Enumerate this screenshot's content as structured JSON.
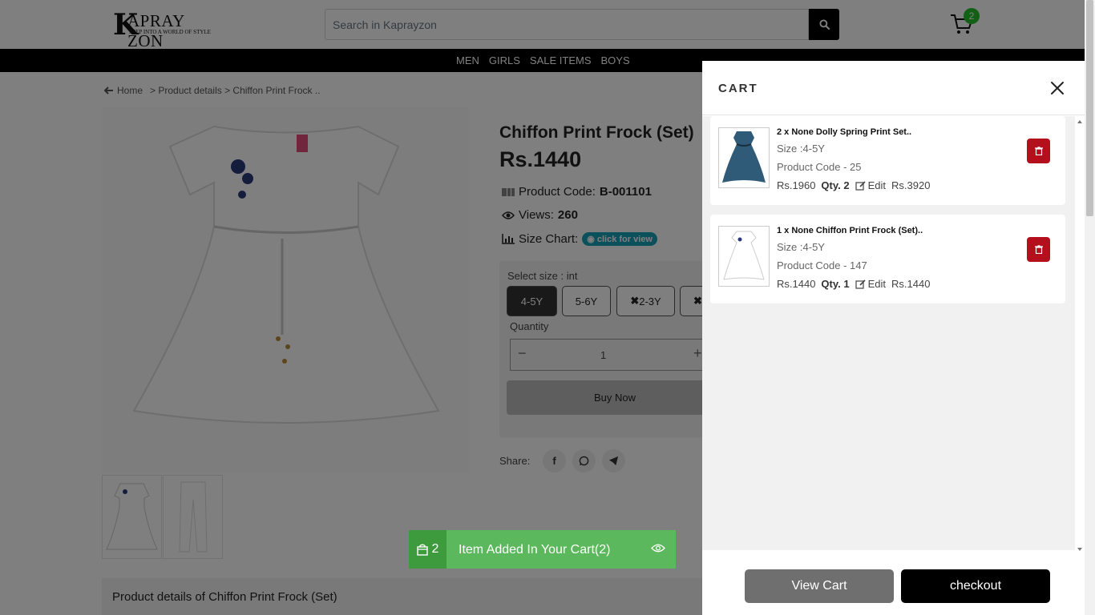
{
  "header": {
    "logo": {
      "letter": "K",
      "name": "APRAY ZON",
      "tagline": "STEP INTO A WORLD OF STYLE"
    },
    "search_placeholder": "Search in Kaprayzon",
    "cart_count": "2"
  },
  "nav": [
    "MEN",
    "GIRLS",
    "SALE ITEMS",
    "BOYS"
  ],
  "breadcrumb": {
    "home": "Home",
    "trail": "> Product details > Chiffon Print Frock .."
  },
  "product": {
    "title": "Chiffon Print Frock (Set)",
    "price": "Rs.1440",
    "code_label": "Product Code:",
    "code": "B-001101",
    "views_label": "Views:",
    "views": "260",
    "size_chart_label": "Size Chart:",
    "size_chart_link": "click for view",
    "select_size_label": "Select size : int",
    "sizes": [
      "4-5Y",
      "5-6Y",
      "2-3Y",
      ""
    ],
    "quantity_label": "Quantity",
    "quantity": "1",
    "buy_now": "Buy Now",
    "share_label": "Share:",
    "details_heading": "Product details of Chiffon Print Frock (Set)"
  },
  "toast": {
    "count": "2",
    "message": "Item Added In Your Cart(2)"
  },
  "cart": {
    "title": "CART",
    "items": [
      {
        "name": "2 x None Dolly Spring Print Set..",
        "size": "Size :4-5Y",
        "code": "Product Code - 25",
        "unit_price": "Rs.1960",
        "qty": "Qty. 2",
        "edit": "Edit",
        "total": "Rs.3920"
      },
      {
        "name": "1 x None Chiffon Print Frock (Set)..",
        "size": "Size :4-5Y",
        "code": "Product Code - 147",
        "unit_price": "Rs.1440",
        "qty": "Qty. 1",
        "edit": "Edit",
        "total": "Rs.1440"
      }
    ],
    "view_cart": "View Cart",
    "checkout": "checkout"
  },
  "colors": {
    "badge": "#22c02d",
    "toast": "#5cb85c",
    "delete": "#b30f1c",
    "size_chart_pill": "#17a2b8"
  }
}
